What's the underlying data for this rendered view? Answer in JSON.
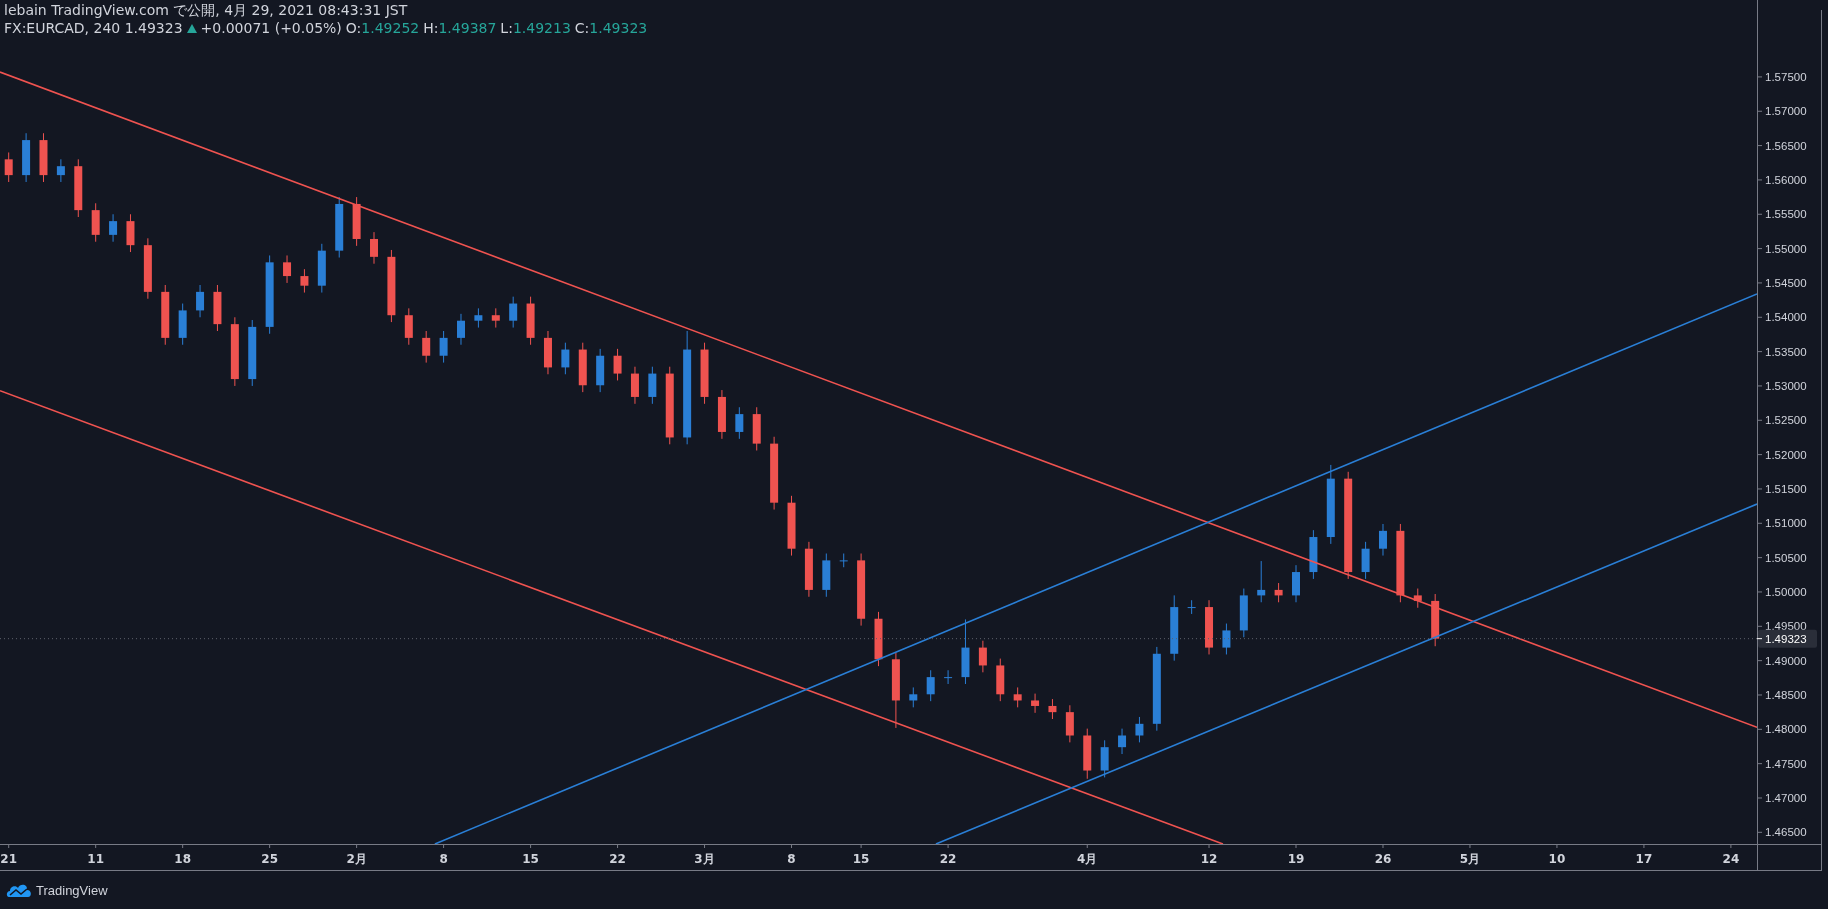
{
  "header": {
    "publisher_line": "lebain TradingView.com で公開, 4月 29, 2021 08:43:31 JST",
    "symbol": "FX:EURCAD, 240 1.49323",
    "change": "+0.00071 (+0.05%)",
    "ohlc": [
      {
        "label": "O:",
        "value": "1.49252"
      },
      {
        "label": "H:",
        "value": "1.49387"
      },
      {
        "label": "L:",
        "value": "1.49213"
      },
      {
        "label": "C:",
        "value": "1.49323"
      }
    ]
  },
  "chart": {
    "candle_styles": [
      {
        "kind": "up",
        "color": "#2a7fd6"
      },
      {
        "kind": "down",
        "color": "#ef5350"
      }
    ],
    "last_price_label": "1.49323",
    "chart_data": {
      "type": "candlestick",
      "categories": [
        "21",
        null,
        null,
        null,
        null,
        "11",
        null,
        null,
        null,
        null,
        "18",
        null,
        null,
        null,
        null,
        "25",
        null,
        null,
        null,
        null,
        "2月",
        null,
        null,
        null,
        null,
        "8",
        null,
        null,
        null,
        null,
        "15",
        null,
        null,
        null,
        null,
        "22",
        null,
        null,
        null,
        null,
        "3月",
        null,
        null,
        null,
        null,
        "8",
        null,
        null,
        null,
        "15",
        null,
        null,
        null,
        null,
        "22",
        null,
        null,
        null,
        null,
        null,
        null,
        null,
        "4月",
        null,
        null,
        null,
        null,
        null,
        null,
        "12",
        null,
        null,
        null,
        null,
        "19",
        null,
        null,
        null,
        null,
        "26",
        null,
        null,
        null,
        null,
        "5月",
        null,
        null,
        null,
        null,
        "10",
        null,
        null,
        null,
        null,
        "17",
        null,
        null,
        null,
        null,
        "24",
        null
      ],
      "ohlc": [
        [
          1.563,
          1.564,
          1.5597,
          1.5607
        ],
        [
          1.5607,
          1.5668,
          1.5597,
          1.5658
        ],
        [
          1.5658,
          1.5668,
          1.5597,
          1.5607
        ],
        [
          1.5607,
          1.563,
          1.5597,
          1.562
        ],
        [
          1.562,
          1.563,
          1.5546,
          1.5556
        ],
        [
          1.5556,
          1.5566,
          1.551,
          1.552
        ],
        [
          1.552,
          1.555,
          1.551,
          1.554
        ],
        [
          1.554,
          1.555,
          1.5495,
          1.5505
        ],
        [
          1.5505,
          1.5515,
          1.5427,
          1.5437
        ],
        [
          1.5437,
          1.5447,
          1.536,
          1.537
        ],
        [
          1.537,
          1.542,
          1.536,
          1.541
        ],
        [
          1.541,
          1.5447,
          1.54,
          1.5437
        ],
        [
          1.5437,
          1.5447,
          1.538,
          1.539
        ],
        [
          1.539,
          1.54,
          1.53,
          1.531
        ],
        [
          1.531,
          1.5396,
          1.53,
          1.5386
        ],
        [
          1.5386,
          1.549,
          1.5376,
          1.548
        ],
        [
          1.548,
          1.549,
          1.545,
          1.546
        ],
        [
          1.546,
          1.547,
          1.5436,
          1.5446
        ],
        [
          1.5446,
          1.5507,
          1.5436,
          1.5497
        ],
        [
          1.5497,
          1.5575,
          1.5487,
          1.5565
        ],
        [
          1.5565,
          1.5575,
          1.5504,
          1.5514
        ],
        [
          1.5514,
          1.5524,
          1.5478,
          1.5488
        ],
        [
          1.5488,
          1.5498,
          1.5393,
          1.5403
        ],
        [
          1.5403,
          1.5413,
          1.536,
          1.537
        ],
        [
          1.537,
          1.538,
          1.5334,
          1.5344
        ],
        [
          1.5344,
          1.538,
          1.5334,
          1.537
        ],
        [
          1.537,
          1.5405,
          1.536,
          1.5395
        ],
        [
          1.5395,
          1.5413,
          1.5385,
          1.5403
        ],
        [
          1.5403,
          1.5413,
          1.5385,
          1.5395
        ],
        [
          1.5395,
          1.543,
          1.5385,
          1.542
        ],
        [
          1.542,
          1.543,
          1.536,
          1.537
        ],
        [
          1.537,
          1.538,
          1.5317,
          1.5327
        ],
        [
          1.5327,
          1.5363,
          1.5317,
          1.5353
        ],
        [
          1.5353,
          1.5363,
          1.5291,
          1.5301
        ],
        [
          1.5301,
          1.5354,
          1.5291,
          1.5344
        ],
        [
          1.5344,
          1.5354,
          1.5308,
          1.5318
        ],
        [
          1.5318,
          1.5328,
          1.5274,
          1.5284
        ],
        [
          1.5284,
          1.5328,
          1.5274,
          1.5318
        ],
        [
          1.5318,
          1.5328,
          1.5215,
          1.5225
        ],
        [
          1.5225,
          1.538,
          1.5215,
          1.5353
        ],
        [
          1.5353,
          1.5363,
          1.5274,
          1.5284
        ],
        [
          1.5284,
          1.5294,
          1.5223,
          1.5233
        ],
        [
          1.5233,
          1.5269,
          1.5223,
          1.5259
        ],
        [
          1.5259,
          1.5269,
          1.5206,
          1.5216
        ],
        [
          1.5216,
          1.5226,
          1.512,
          1.513
        ],
        [
          1.513,
          1.514,
          1.5053,
          1.5063
        ],
        [
          1.5063,
          1.5073,
          1.4993,
          1.5003
        ],
        [
          1.5003,
          1.5056,
          1.4993,
          1.5046
        ],
        [
          1.5046,
          1.5056,
          1.5036,
          1.5046
        ],
        [
          1.5046,
          1.5056,
          1.4951,
          1.4961
        ],
        [
          1.4961,
          1.4971,
          1.4892,
          1.4902
        ],
        [
          1.4902,
          1.4912,
          1.4802,
          1.4842
        ],
        [
          1.4842,
          1.4861,
          1.4832,
          1.4851
        ],
        [
          1.4851,
          1.4886,
          1.4841,
          1.4876
        ],
        [
          1.4876,
          1.4886,
          1.4866,
          1.4876
        ],
        [
          1.4876,
          1.496,
          1.4866,
          1.4919
        ],
        [
          1.4919,
          1.4929,
          1.4883,
          1.4893
        ],
        [
          1.4893,
          1.4903,
          1.4841,
          1.4851
        ],
        [
          1.4851,
          1.4861,
          1.4832,
          1.4842
        ],
        [
          1.4842,
          1.4852,
          1.4824,
          1.4834
        ],
        [
          1.4834,
          1.4844,
          1.4815,
          1.4825
        ],
        [
          1.4825,
          1.4835,
          1.4781,
          1.4791
        ],
        [
          1.4791,
          1.4801,
          1.4728,
          1.474
        ],
        [
          1.474,
          1.4784,
          1.473,
          1.4774
        ],
        [
          1.4774,
          1.4801,
          1.4764,
          1.4791
        ],
        [
          1.4791,
          1.4818,
          1.4781,
          1.4808
        ],
        [
          1.4808,
          1.492,
          1.4798,
          1.491
        ],
        [
          1.491,
          1.4995,
          1.49,
          1.4978
        ],
        [
          1.4978,
          1.4988,
          1.4968,
          1.4978
        ],
        [
          1.4978,
          1.4988,
          1.4909,
          1.4919
        ],
        [
          1.4919,
          1.4954,
          1.4909,
          1.4944
        ],
        [
          1.4944,
          1.5005,
          1.4934,
          1.4995
        ],
        [
          1.4995,
          1.5045,
          1.4985,
          1.5003
        ],
        [
          1.5003,
          1.5013,
          1.4985,
          1.4995
        ],
        [
          1.4995,
          1.5039,
          1.4985,
          1.5029
        ],
        [
          1.5029,
          1.509,
          1.5019,
          1.508
        ],
        [
          1.508,
          1.5185,
          1.507,
          1.5165
        ],
        [
          1.5165,
          1.5175,
          1.5019,
          1.5029
        ],
        [
          1.5029,
          1.5073,
          1.5019,
          1.5063
        ],
        [
          1.5063,
          1.5099,
          1.5053,
          1.5089
        ],
        [
          1.5089,
          1.5099,
          1.4985,
          1.4995
        ],
        [
          1.4995,
          1.5005,
          1.4977,
          1.4987
        ],
        [
          1.4987,
          1.4997,
          1.4921,
          1.4932
        ],
        null,
        null,
        null,
        null,
        null,
        null,
        null,
        null,
        null,
        null,
        null,
        null,
        null,
        null,
        null,
        null,
        null,
        null
      ],
      "ylim": [
        1.4633,
        1.5862
      ],
      "yticks": [
        {
          "value": 1.465,
          "label": "1.46500"
        },
        {
          "value": 1.47,
          "label": "1.47000"
        },
        {
          "value": 1.475,
          "label": "1.47500"
        },
        {
          "value": 1.48,
          "label": "1.48000"
        },
        {
          "value": 1.485,
          "label": "1.48500"
        },
        {
          "value": 1.49,
          "label": "1.49000"
        },
        {
          "value": 1.495,
          "label": "1.49500"
        },
        {
          "value": 1.5,
          "label": "1.50000"
        },
        {
          "value": 1.505,
          "label": "1.50500"
        },
        {
          "value": 1.51,
          "label": "1.51000"
        },
        {
          "value": 1.515,
          "label": "1.51500"
        },
        {
          "value": 1.52,
          "label": "1.52000"
        },
        {
          "value": 1.525,
          "label": "1.52500"
        },
        {
          "value": 1.53,
          "label": "1.53000"
        },
        {
          "value": 1.535,
          "label": "1.53500"
        },
        {
          "value": 1.54,
          "label": "1.54000"
        },
        {
          "value": 1.545,
          "label": "1.54500"
        },
        {
          "value": 1.55,
          "label": "1.55000"
        },
        {
          "value": 1.555,
          "label": "1.55500"
        },
        {
          "value": 1.56,
          "label": "1.56000"
        },
        {
          "value": 1.565,
          "label": "1.56500"
        },
        {
          "value": 1.57,
          "label": "1.57000"
        },
        {
          "value": 1.575,
          "label": "1.57500"
        }
      ]
    }
  },
  "footer": {
    "brand": "TradingView"
  }
}
